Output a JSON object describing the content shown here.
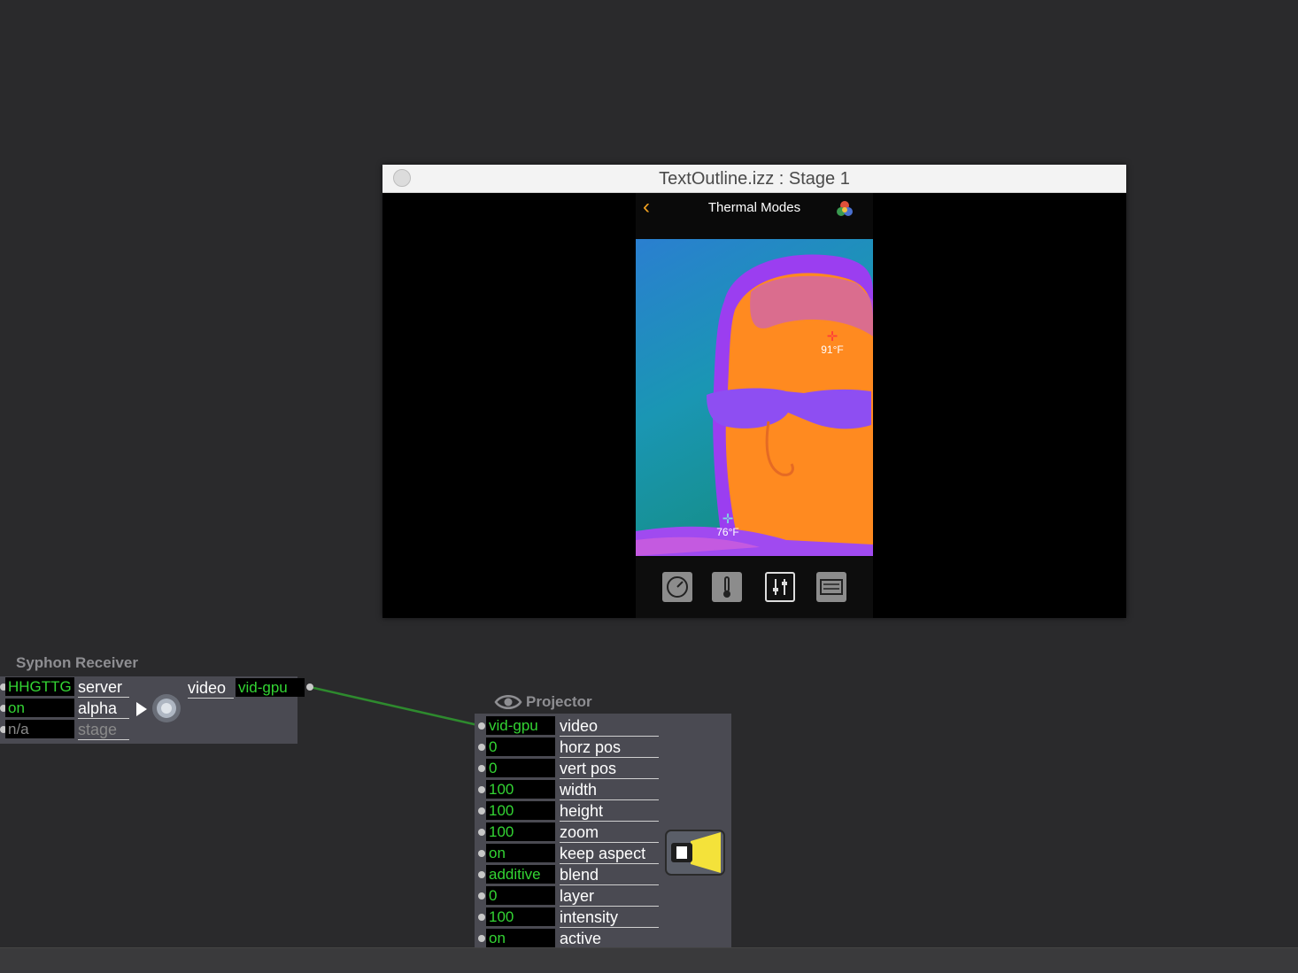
{
  "stage_window": {
    "title": "TextOutline.izz : Stage 1",
    "phone": {
      "back_glyph": "‹",
      "title": "Thermal Modes",
      "palette_icon": "palette-icon",
      "hot_marker": "91°F",
      "cold_marker": "76°F",
      "toolbar_icons": [
        "gauge-icon",
        "thermometer-icon",
        "sliders-icon",
        "keyboard-icon"
      ]
    }
  },
  "syphon_receiver": {
    "title": "Syphon Receiver",
    "inputs": [
      {
        "value": "HHGTTG",
        "label": "server"
      },
      {
        "value": "on",
        "label": "alpha"
      },
      {
        "value": "n/a",
        "label": "stage"
      }
    ],
    "output": {
      "label": "video",
      "value": "vid-gpu"
    }
  },
  "projector": {
    "title": "Projector",
    "inputs": [
      {
        "value": "vid-gpu",
        "label": "video"
      },
      {
        "value": "0",
        "label": "horz pos"
      },
      {
        "value": "0",
        "label": "vert pos"
      },
      {
        "value": "100",
        "label": "width"
      },
      {
        "value": "100",
        "label": "height"
      },
      {
        "value": "100",
        "label": "zoom"
      },
      {
        "value": "on",
        "label": "keep aspect"
      },
      {
        "value": "additive",
        "label": "blend"
      },
      {
        "value": "0",
        "label": "layer"
      },
      {
        "value": "100",
        "label": "intensity"
      },
      {
        "value": "on",
        "label": "active"
      }
    ]
  },
  "colors": {
    "background": "#2a2a2c",
    "node_body": "#4a4a52",
    "value_text": "#33d533",
    "wire": "#2e8a2e",
    "accent_back": "#f0a020"
  }
}
